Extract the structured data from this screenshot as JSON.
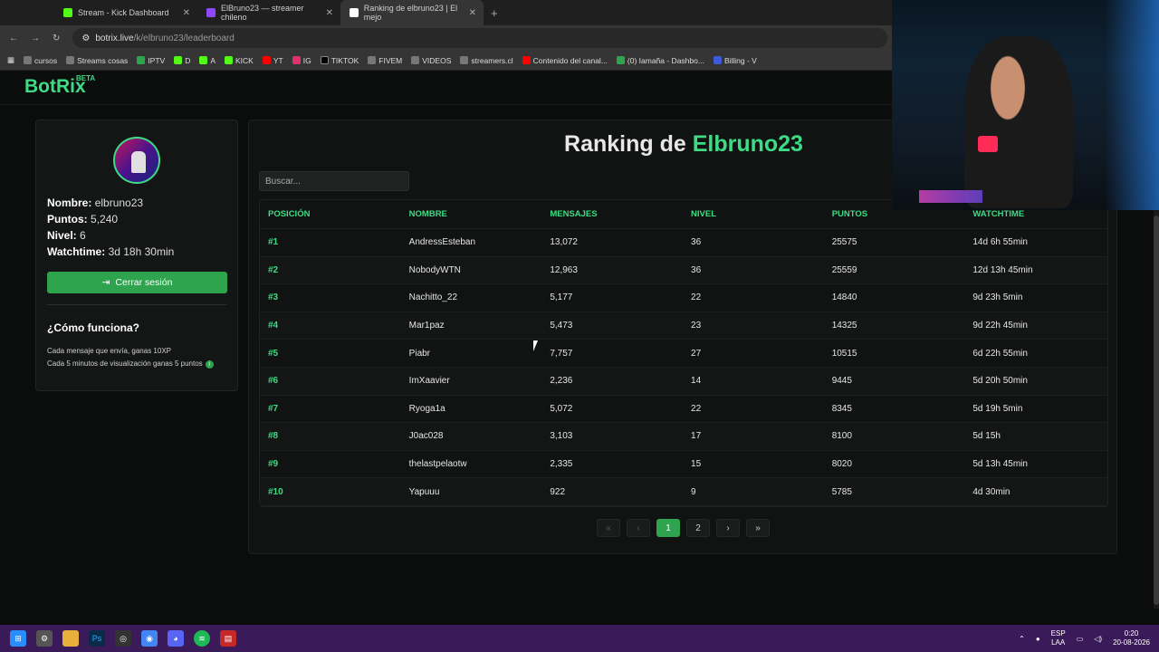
{
  "browser": {
    "tabs": [
      {
        "title": "Stream - Kick Dashboard",
        "icon_color": "#53fc18",
        "active": false
      },
      {
        "title": "ElBruno23 — streamer chileno",
        "icon_color": "#9146ff",
        "active": false
      },
      {
        "title": "Ranking de elbruno23 | El mejo",
        "icon_color": "#ffffff",
        "active": true
      }
    ],
    "url_host": "botrix.live",
    "url_path": "/k/elbruno23/leaderboard",
    "bookmarks": [
      "cursos",
      "Streams cosas",
      "IPTV",
      "D",
      "A",
      "KICK",
      "YT",
      "IG",
      "TIKTOK",
      "FIVEM",
      "VIDEOS",
      "streamers.cl",
      "Contenido del canal...",
      "(0) Iamaña - Dashbo...",
      "Billing - V"
    ]
  },
  "site": {
    "logo": "BotRix",
    "badge": "BETA"
  },
  "profile": {
    "name_label": "Nombre:",
    "name_value": "elbruno23",
    "points_label": "Puntos:",
    "points_value": "5,240",
    "level_label": "Nivel:",
    "level_value": "6",
    "watchtime_label": "Watchtime:",
    "watchtime_value": "3d 18h 30min",
    "logout_label": "Cerrar sesión",
    "how_title": "¿Cómo funciona?",
    "how_line1": "Cada mensaje que envía, ganas 10XP",
    "how_line2": "Cada 5 minutos de visualización ganas 5 puntos"
  },
  "ranking": {
    "title_prefix": "Ranking de",
    "title_name": "Elbruno23",
    "search_placeholder": "Buscar...",
    "columns": [
      "POSICIÓN",
      "NOMBRE",
      "MENSAJES",
      "NIVEL",
      "PUNTOS",
      "WATCHTIME"
    ],
    "rows": [
      [
        "#1",
        "AndressEsteban",
        "13,072",
        "36",
        "25575",
        "14d 6h 55min"
      ],
      [
        "#2",
        "NobodyWTN",
        "12,963",
        "36",
        "25559",
        "12d 13h 45min"
      ],
      [
        "#3",
        "Nachitto_22",
        "5,177",
        "22",
        "14840",
        "9d 23h 5min"
      ],
      [
        "#4",
        "Mar1paz",
        "5,473",
        "23",
        "14325",
        "9d 22h 45min"
      ],
      [
        "#5",
        "Piabr",
        "7,757",
        "27",
        "10515",
        "6d 22h 55min"
      ],
      [
        "#6",
        "ImXaavier",
        "2,236",
        "14",
        "9445",
        "5d 20h 50min"
      ],
      [
        "#7",
        "Ryoga1a",
        "5,072",
        "22",
        "8345",
        "5d 19h 5min"
      ],
      [
        "#8",
        "J0ac028",
        "3,103",
        "17",
        "8100",
        "5d 15h"
      ],
      [
        "#9",
        "thelastpelaotw",
        "2,335",
        "15",
        "8020",
        "5d 13h 45min"
      ],
      [
        "#10",
        "Yapuuu",
        "922",
        "9",
        "5785",
        "4d 30min"
      ]
    ],
    "pagination": {
      "first": "«",
      "prev": "‹",
      "pages": [
        "1",
        "2"
      ],
      "current": "1",
      "next": "›",
      "last": "»"
    }
  },
  "taskbar": {
    "lang_top": "ESP",
    "lang_bottom": "LAA",
    "time": "0:20",
    "date": "20-08-2026"
  }
}
